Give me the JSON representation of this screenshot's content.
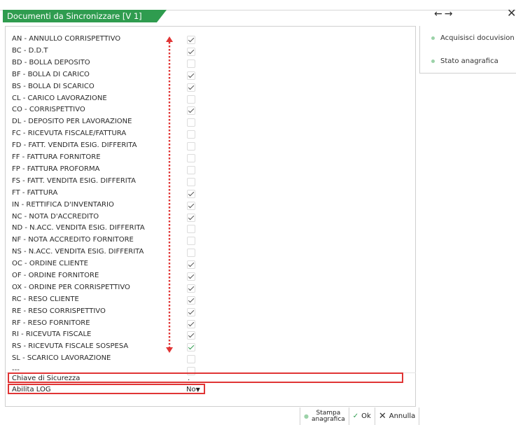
{
  "window": {
    "title": "Documenti da Sincronizzare [V 1]",
    "nav_arrows": "←→",
    "close_glyph": "✕"
  },
  "side_actions": [
    {
      "label": "Acquisisci docuvision"
    },
    {
      "label": "Stato anagrafica"
    }
  ],
  "documents": [
    {
      "label": "AN - ANNULLO CORRISPETTIVO",
      "checked": true
    },
    {
      "label": "BC - D.D.T",
      "checked": true
    },
    {
      "label": "BD - BOLLA DEPOSITO",
      "checked": false
    },
    {
      "label": "BF - BOLLA DI CARICO",
      "checked": true
    },
    {
      "label": "BS - BOLLA DI SCARICO",
      "checked": true
    },
    {
      "label": "CL - CARICO LAVORAZIONE",
      "checked": false
    },
    {
      "label": "CO - CORRISPETTIVO",
      "checked": true
    },
    {
      "label": "DL - DEPOSITO PER LAVORAZIONE",
      "checked": false
    },
    {
      "label": "FC - RICEVUTA FISCALE/FATTURA",
      "checked": false
    },
    {
      "label": "FD - FATT. VENDITA ESIG. DIFFERITA",
      "checked": false
    },
    {
      "label": "FF - FATTURA FORNITORE",
      "checked": false
    },
    {
      "label": "FP - FATTURA PROFORMA",
      "checked": false
    },
    {
      "label": "FS - FATT. VENDITA ESIG. DIFFERITA",
      "checked": false
    },
    {
      "label": "FT - FATTURA",
      "checked": true
    },
    {
      "label": "IN - RETTIFICA D'INVENTARIO",
      "checked": true
    },
    {
      "label": "NC - NOTA D'ACCREDITO",
      "checked": true
    },
    {
      "label": "ND - N.ACC. VENDITA ESIG. DIFFERITA",
      "checked": false
    },
    {
      "label": "NF - NOTA ACCREDITO FORNITORE",
      "checked": false
    },
    {
      "label": "NS - N.ACC. VENDITA ESIG. DIFFERITA",
      "checked": false
    },
    {
      "label": "OC - ORDINE CLIENTE",
      "checked": true
    },
    {
      "label": "OF - ORDINE FORNITORE",
      "checked": true
    },
    {
      "label": "OX - ORDINE PER CORRISPETTIVO",
      "checked": true
    },
    {
      "label": "RC - RESO CLIENTE",
      "checked": true
    },
    {
      "label": "RE - RESO CORRISPETTIVO",
      "checked": true
    },
    {
      "label": "RF - RESO FORNITORE",
      "checked": true
    },
    {
      "label": "RI - RICEVUTA FISCALE",
      "checked": true
    },
    {
      "label": "RS - RICEVUTA FISCALE SOSPESA",
      "checked": true,
      "accent": true
    },
    {
      "label": "SL - SCARICO LAVORAZIONE",
      "checked": false
    },
    {
      "label": "---",
      "checked": false
    }
  ],
  "fields": {
    "security_key_label": "Chiave di Sicurezza",
    "security_key_value": ".",
    "log_label": "Abilita LOG",
    "log_value": "No"
  },
  "toolbar": {
    "print_label_line1": "Stampa",
    "print_label_line2": "anagrafica",
    "ok_label": "Ok",
    "cancel_label": "Annulla"
  },
  "colors": {
    "title_bg": "#2f9c4f",
    "highlight_border": "#e03535",
    "arrow_red": "#e03535"
  }
}
